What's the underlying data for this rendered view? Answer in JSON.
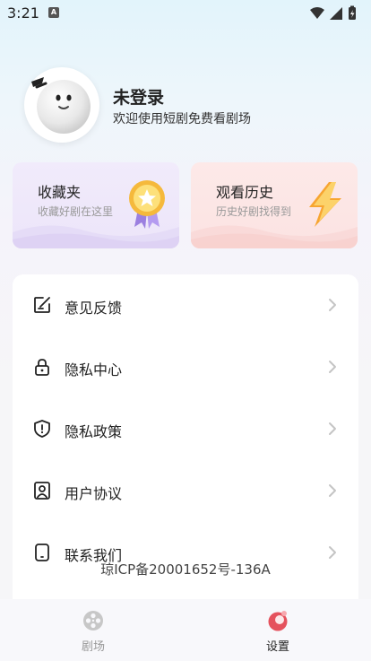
{
  "status_bar": {
    "time": "3:21",
    "notification_letter": "A"
  },
  "profile": {
    "username": "未登录",
    "welcome": "欢迎使用短剧免费看剧场"
  },
  "cards": [
    {
      "title": "收藏夹",
      "subtitle": "收藏好剧在这里",
      "icon": "medal-icon"
    },
    {
      "title": "观看历史",
      "subtitle": "历史好剧找得到",
      "icon": "lightning-icon"
    }
  ],
  "menu": {
    "items": [
      {
        "label": "意见反馈",
        "icon": "feedback-icon"
      },
      {
        "label": "隐私中心",
        "icon": "lock-icon"
      },
      {
        "label": "隐私政策",
        "icon": "shield-icon"
      },
      {
        "label": "用户协议",
        "icon": "agreement-icon"
      },
      {
        "label": "联系我们",
        "icon": "phone-icon"
      }
    ]
  },
  "icp": "琼ICP备20001652号-136A",
  "tabbar": {
    "tabs": [
      {
        "label": "剧场",
        "icon": "film-reel-icon",
        "active": false
      },
      {
        "label": "设置",
        "icon": "settings-tab-icon",
        "active": true
      }
    ]
  },
  "colors": {
    "active_tab": "#e5525d",
    "inactive_tab": "#bbbbbb",
    "chevron": "#c4c4c4"
  }
}
